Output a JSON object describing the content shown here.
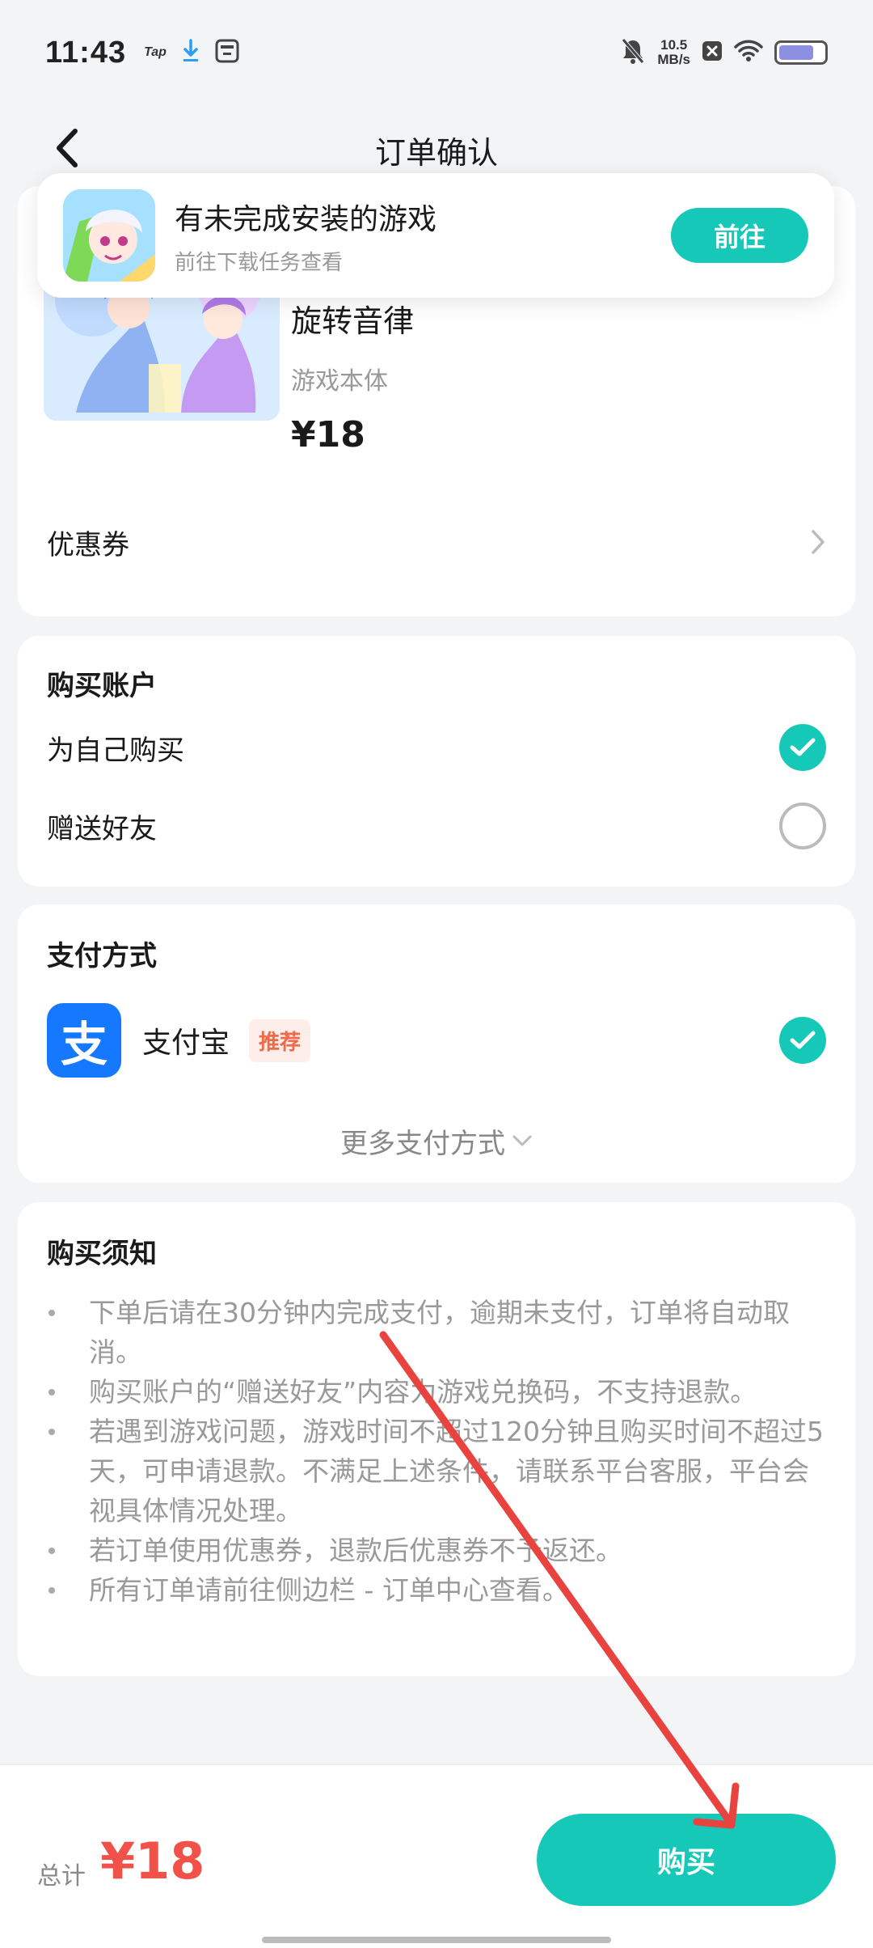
{
  "status_bar": {
    "time": "11:43",
    "tap_logo": "Tap",
    "net_speed_value": "10.5",
    "net_speed_unit": "MB/s",
    "icons": [
      "download-icon",
      "storage-icon",
      "mute-bell-icon",
      "close-box-icon",
      "wifi-icon",
      "battery-icon"
    ]
  },
  "header": {
    "title": "订单确认",
    "back_icon": "chevron-left-icon"
  },
  "toast": {
    "title": "有未完成安装的游戏",
    "subtitle": "前往下载任务查看",
    "button": "前往"
  },
  "product": {
    "name": "旋转音律",
    "type": "游戏本体",
    "price": "¥18",
    "coupon_label": "优惠券"
  },
  "account": {
    "title": "购买账户",
    "options": [
      {
        "label": "为自己购买",
        "selected": true
      },
      {
        "label": "赠送好友",
        "selected": false
      }
    ]
  },
  "payment": {
    "title": "支付方式",
    "method_icon_text": "支",
    "method": "支付宝",
    "badge": "推荐",
    "more": "更多支付方式"
  },
  "notice": {
    "title": "购买须知",
    "items": [
      "下单后请在30分钟内完成支付，逾期未支付，订单将自动取消。",
      "购买账户的“赠送好友”内容为游戏兑换码，不支持退款。",
      "若遇到游戏问题，游戏时间不超过120分钟且购买时间不超过5天，可申请退款。不满足上述条件，请联系平台客服，平台会视具体情况处理。",
      "若订单使用优惠券，退款后优惠券不予返还。",
      "所有订单请前往侧边栏 - 订单中心查看。"
    ]
  },
  "footer": {
    "total_label": "总计",
    "total_price": "¥18",
    "buy_button": "购买"
  },
  "colors": {
    "accent": "#15c8b8",
    "price_red": "#f0524a",
    "alipay_blue": "#1677ff",
    "badge_text": "#f06a4a",
    "annotation_arrow": "#e8433f"
  }
}
